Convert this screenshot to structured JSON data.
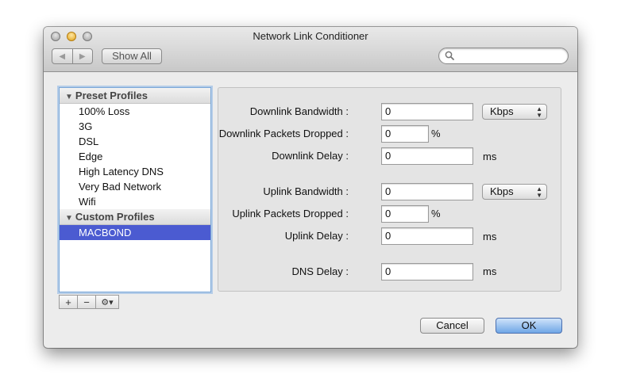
{
  "window": {
    "title": "Network Link Conditioner"
  },
  "toolbar": {
    "back_icon": "left-arrow",
    "forward_icon": "right-arrow",
    "show_all_label": "Show All",
    "search_placeholder": "",
    "search_value": ""
  },
  "sidebar": {
    "groups": [
      {
        "label": "Preset Profiles",
        "items": [
          "100% Loss",
          "3G",
          "DSL",
          "Edge",
          "High Latency DNS",
          "Very Bad Network",
          "Wifi"
        ]
      },
      {
        "label": "Custom Profiles",
        "items": [
          "MACBOND"
        ]
      }
    ],
    "selected": "MACBOND",
    "buttons": {
      "add": "+",
      "remove": "−",
      "gear": "⚙▾"
    }
  },
  "settings": {
    "downlink_bandwidth": {
      "label": "Downlink Bandwidth :",
      "value": "0",
      "unit": "Kbps"
    },
    "downlink_dropped": {
      "label": "Downlink Packets Dropped :",
      "value": "0",
      "unit": "%"
    },
    "downlink_delay": {
      "label": "Downlink Delay :",
      "value": "0",
      "unit": "ms"
    },
    "uplink_bandwidth": {
      "label": "Uplink Bandwidth :",
      "value": "0",
      "unit": "Kbps"
    },
    "uplink_dropped": {
      "label": "Uplink Packets Dropped :",
      "value": "0",
      "unit": "%"
    },
    "uplink_delay": {
      "label": "Uplink Delay :",
      "value": "0",
      "unit": "ms"
    },
    "dns_delay": {
      "label": "DNS Delay :",
      "value": "0",
      "unit": "ms"
    }
  },
  "footer": {
    "cancel_label": "Cancel",
    "ok_label": "OK"
  }
}
